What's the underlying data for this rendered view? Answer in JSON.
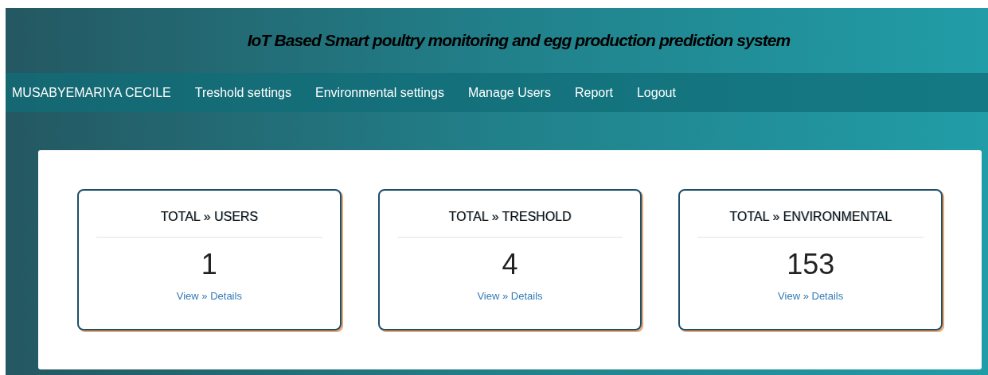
{
  "header": {
    "title": "IoT Based Smart poultry monitoring and egg production prediction system"
  },
  "nav": {
    "items": [
      {
        "label": "MUSABYEMARIYA CECILE"
      },
      {
        "label": "Treshold settings"
      },
      {
        "label": "Environmental settings"
      },
      {
        "label": "Manage Users"
      },
      {
        "label": "Report"
      },
      {
        "label": "Logout"
      }
    ]
  },
  "cards": [
    {
      "title": "TOTAL » USERS",
      "value": "1",
      "link": "View » Details"
    },
    {
      "title": "TOTAL » TRESHOLD",
      "value": "4",
      "link": "View » Details"
    },
    {
      "title": "TOTAL » ENVIRONMENTAL",
      "value": "153",
      "link": "View » Details"
    }
  ]
}
